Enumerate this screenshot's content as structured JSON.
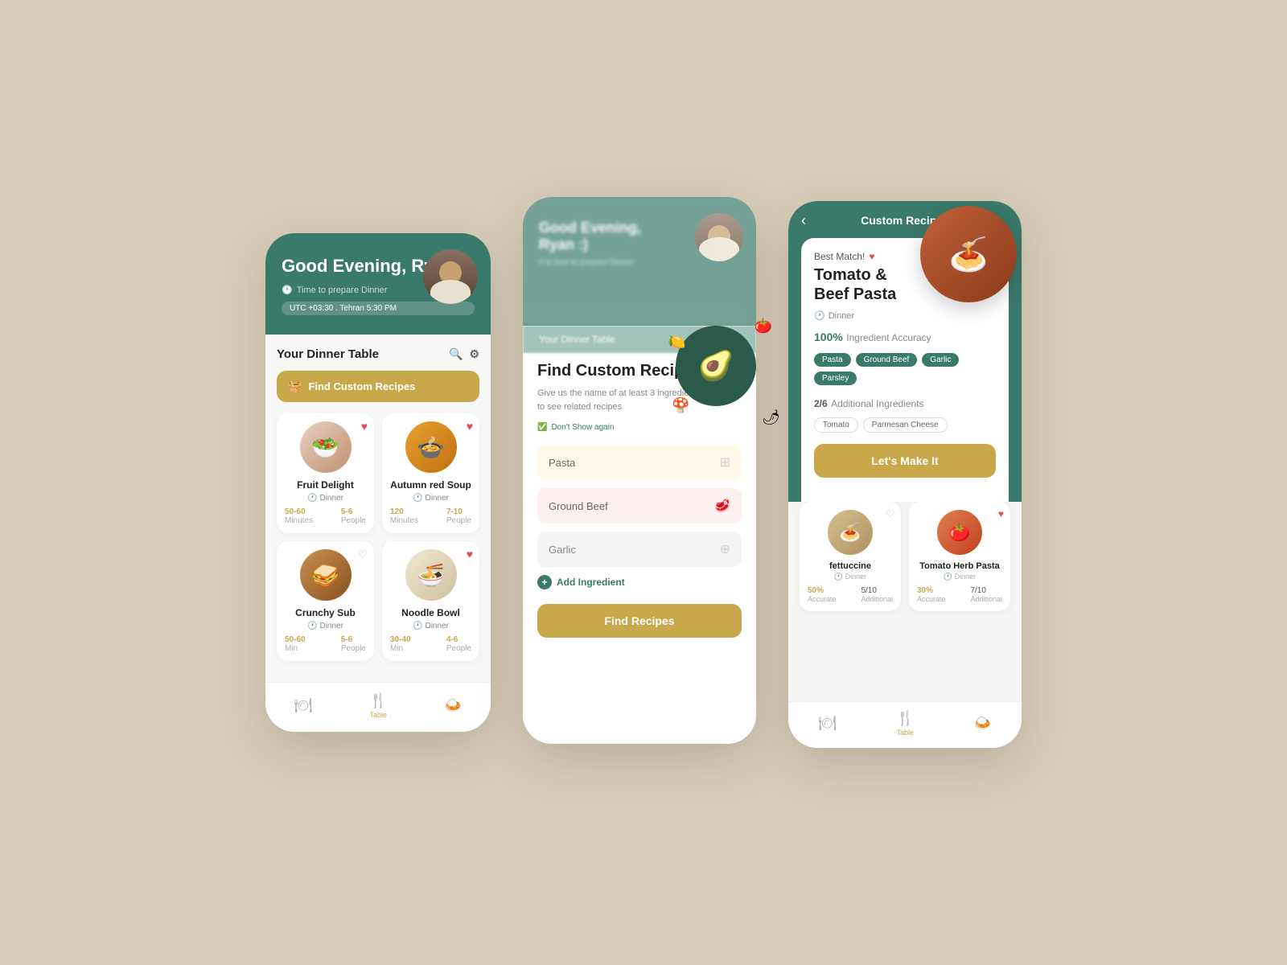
{
  "background": "#d8cdb8",
  "screen1": {
    "header": {
      "greeting": "Good Evening,\nRyan :)",
      "time_label": "Time to prepare Dinner",
      "timezone": "UTC +03:30 . Tehran  5:30 PM"
    },
    "section_title": "Your Dinner Table",
    "find_btn": "Find Custom Recipes",
    "recipes": [
      {
        "name": "Fruit Delight",
        "meal": "Dinner",
        "time": "50-60",
        "time_label": "Minutes",
        "people": "5-6",
        "people_label": "People",
        "heart_color": "#e05050",
        "emoji": "🥗"
      },
      {
        "name": "Autumn red Soup",
        "meal": "Dinner",
        "time": "120",
        "time_label": "Minutes",
        "people": "7-10",
        "people_label": "People",
        "heart_color": "#e05050",
        "emoji": "🍲"
      },
      {
        "name": "Crunchy Sub",
        "meal": "Dinner",
        "time": "50-60",
        "time_label": "Minutes",
        "people": "5-6",
        "people_label": "People",
        "heart_color": "#888",
        "emoji": "🥪"
      },
      {
        "name": "Noodle Bowl",
        "meal": "Dinner",
        "time": "30-40",
        "time_label": "Minutes",
        "people": "4-6",
        "people_label": "People",
        "heart_color": "#e05050",
        "emoji": "🍜"
      }
    ],
    "nav": [
      {
        "label": "",
        "icon": "🍽",
        "active": false
      },
      {
        "label": "Table",
        "icon": "🍴",
        "active": true
      },
      {
        "label": "",
        "icon": "🍛",
        "active": false
      }
    ]
  },
  "screen2": {
    "blur_header": {
      "greeting": "Good Evening,\nRyan :)",
      "sub": "It is time to prepare Dinner"
    },
    "blur_middle": "Your Dinner Table",
    "title": "Find Custom Recipes",
    "subtitle": "Give us the name of at least 3 ingredients you have to see related recipes",
    "dont_show": "Don't Show again",
    "ingredients": [
      {
        "value": "Pasta",
        "type": "pasta"
      },
      {
        "value": "Ground Beef",
        "type": "beef"
      },
      {
        "value": "Garlic",
        "type": "garlic"
      }
    ],
    "add_ingredient": "Add Ingredient",
    "find_btn": "Find Recipes"
  },
  "screen3": {
    "header_title": "Custom Recipes",
    "best_match_label": "Best Match!",
    "recipe": {
      "name": "Tomato &\nBeef Pasta",
      "meal": "Dinner",
      "accuracy_pct": "100%",
      "accuracy_label": "Ingredient Accuracy",
      "tags": [
        "Pasta",
        "Ground Beef",
        "Garlic",
        "Parsley"
      ],
      "additional_count": "2/6",
      "additional_label": "Additional Ingredients",
      "additional_tags": [
        "Tomato",
        "Parmesan Cheese"
      ],
      "cta": "Let's Make It"
    },
    "other_recipes": [
      {
        "name": "fettuccine",
        "meal": "Dinner",
        "accurate": "50%",
        "additional": "5/10",
        "accurate_label": "Accurate",
        "additional_label": "Additional",
        "heart_color": "#888",
        "emoji": "🍝"
      },
      {
        "name": "Tomato Herb Pasta",
        "meal": "Dinner",
        "accurate": "30%",
        "additional": "7/10",
        "accurate_label": "Accurate",
        "additional_label": "Additional",
        "heart_color": "#e05050",
        "emoji": "🍅"
      }
    ],
    "nav": [
      {
        "label": "",
        "icon": "🍽",
        "active": false
      },
      {
        "label": "Table",
        "icon": "🍴",
        "active": true
      },
      {
        "label": "",
        "icon": "🍛",
        "active": false
      }
    ]
  }
}
